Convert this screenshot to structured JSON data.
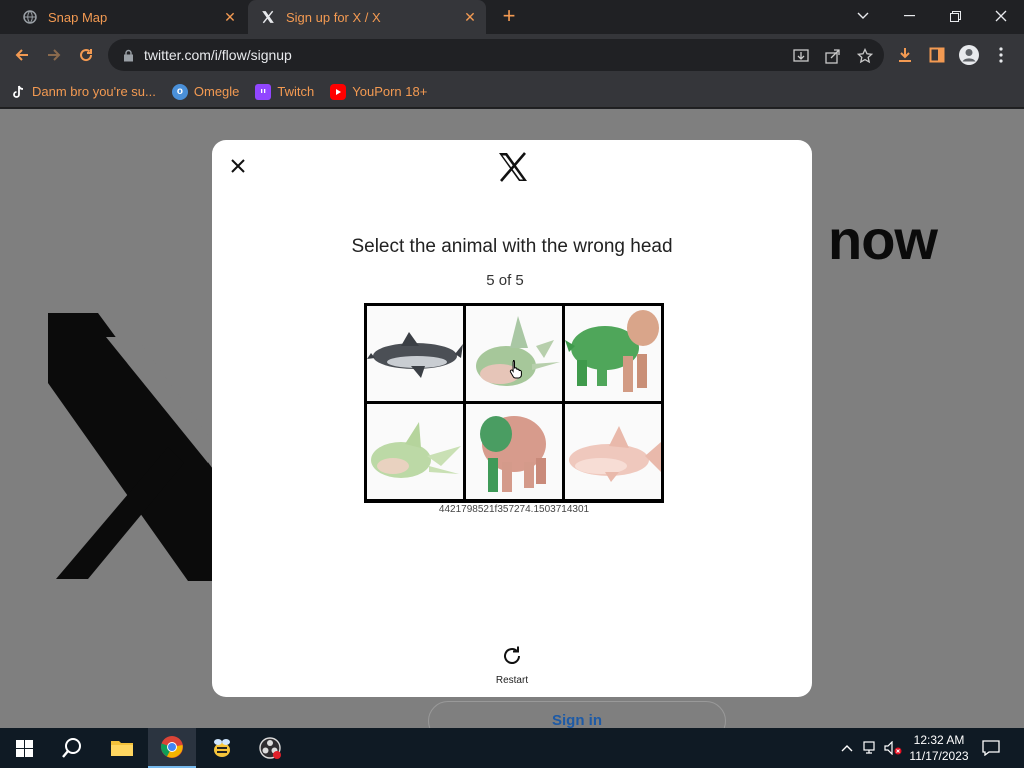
{
  "browser": {
    "tabs": [
      {
        "title": "Snap Map",
        "active": false
      },
      {
        "title": "Sign up for X / X",
        "active": true
      }
    ],
    "url": "twitter.com/i/flow/signup",
    "bookmarks": [
      {
        "label": "Danm bro you're su...",
        "icon": "tiktok-icon"
      },
      {
        "label": "Omegle",
        "icon": "omegle-icon"
      },
      {
        "label": "Twitch",
        "icon": "twitch-icon"
      },
      {
        "label": "YouPorn 18+",
        "icon": "youtube-style-icon"
      }
    ],
    "accent_color": "#f39a52"
  },
  "background_page": {
    "headline_fragment": "now",
    "signin_label": "Sign in"
  },
  "modal": {
    "challenge_title": "Select the animal with the wrong head",
    "progress": "5 of 5",
    "images": [
      {
        "subject": "grey shark"
      },
      {
        "subject": "pale green shark"
      },
      {
        "subject": "green-pink dog"
      },
      {
        "subject": "green shark"
      },
      {
        "subject": "pink-green dog"
      },
      {
        "subject": "pink shark"
      }
    ],
    "session_id": "4421798521f357274.1503714301",
    "restart_label": "Restart"
  },
  "taskbar": {
    "time": "12:32 AM",
    "date": "11/17/2023"
  }
}
